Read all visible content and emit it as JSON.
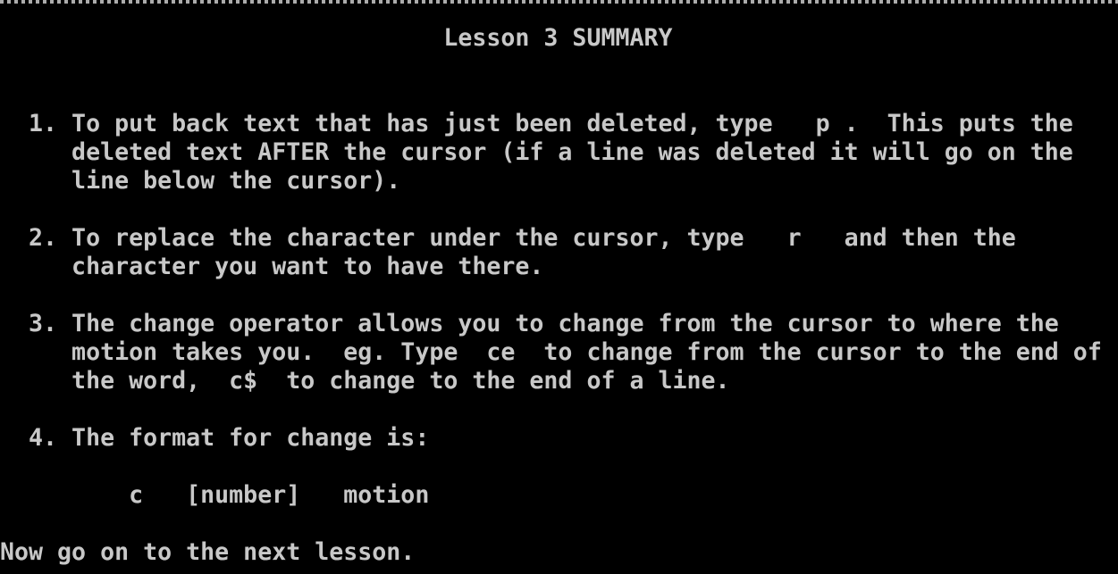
{
  "screen": {
    "title": "                               Lesson 3 SUMMARY",
    "lines": [
      "  1. To put back text that has just been deleted, type   p .  This puts the",
      "     deleted text AFTER the cursor (if a line was deleted it will go on the",
      "     line below the cursor).",
      "  2. To replace the character under the cursor, type   r   and then the",
      "     character you want to have there.",
      "  3. The change operator allows you to change from the cursor to where the",
      "     motion takes you.  eg. Type  ce  to change from the cursor to the end of",
      "     the word,  c$  to change to the end of a line.",
      "  4. The format for change is:",
      "         c   [number]   motion",
      "Now go on to the next lesson."
    ]
  },
  "colors": {
    "background": "#000000",
    "foreground": "#c8c8c8"
  }
}
